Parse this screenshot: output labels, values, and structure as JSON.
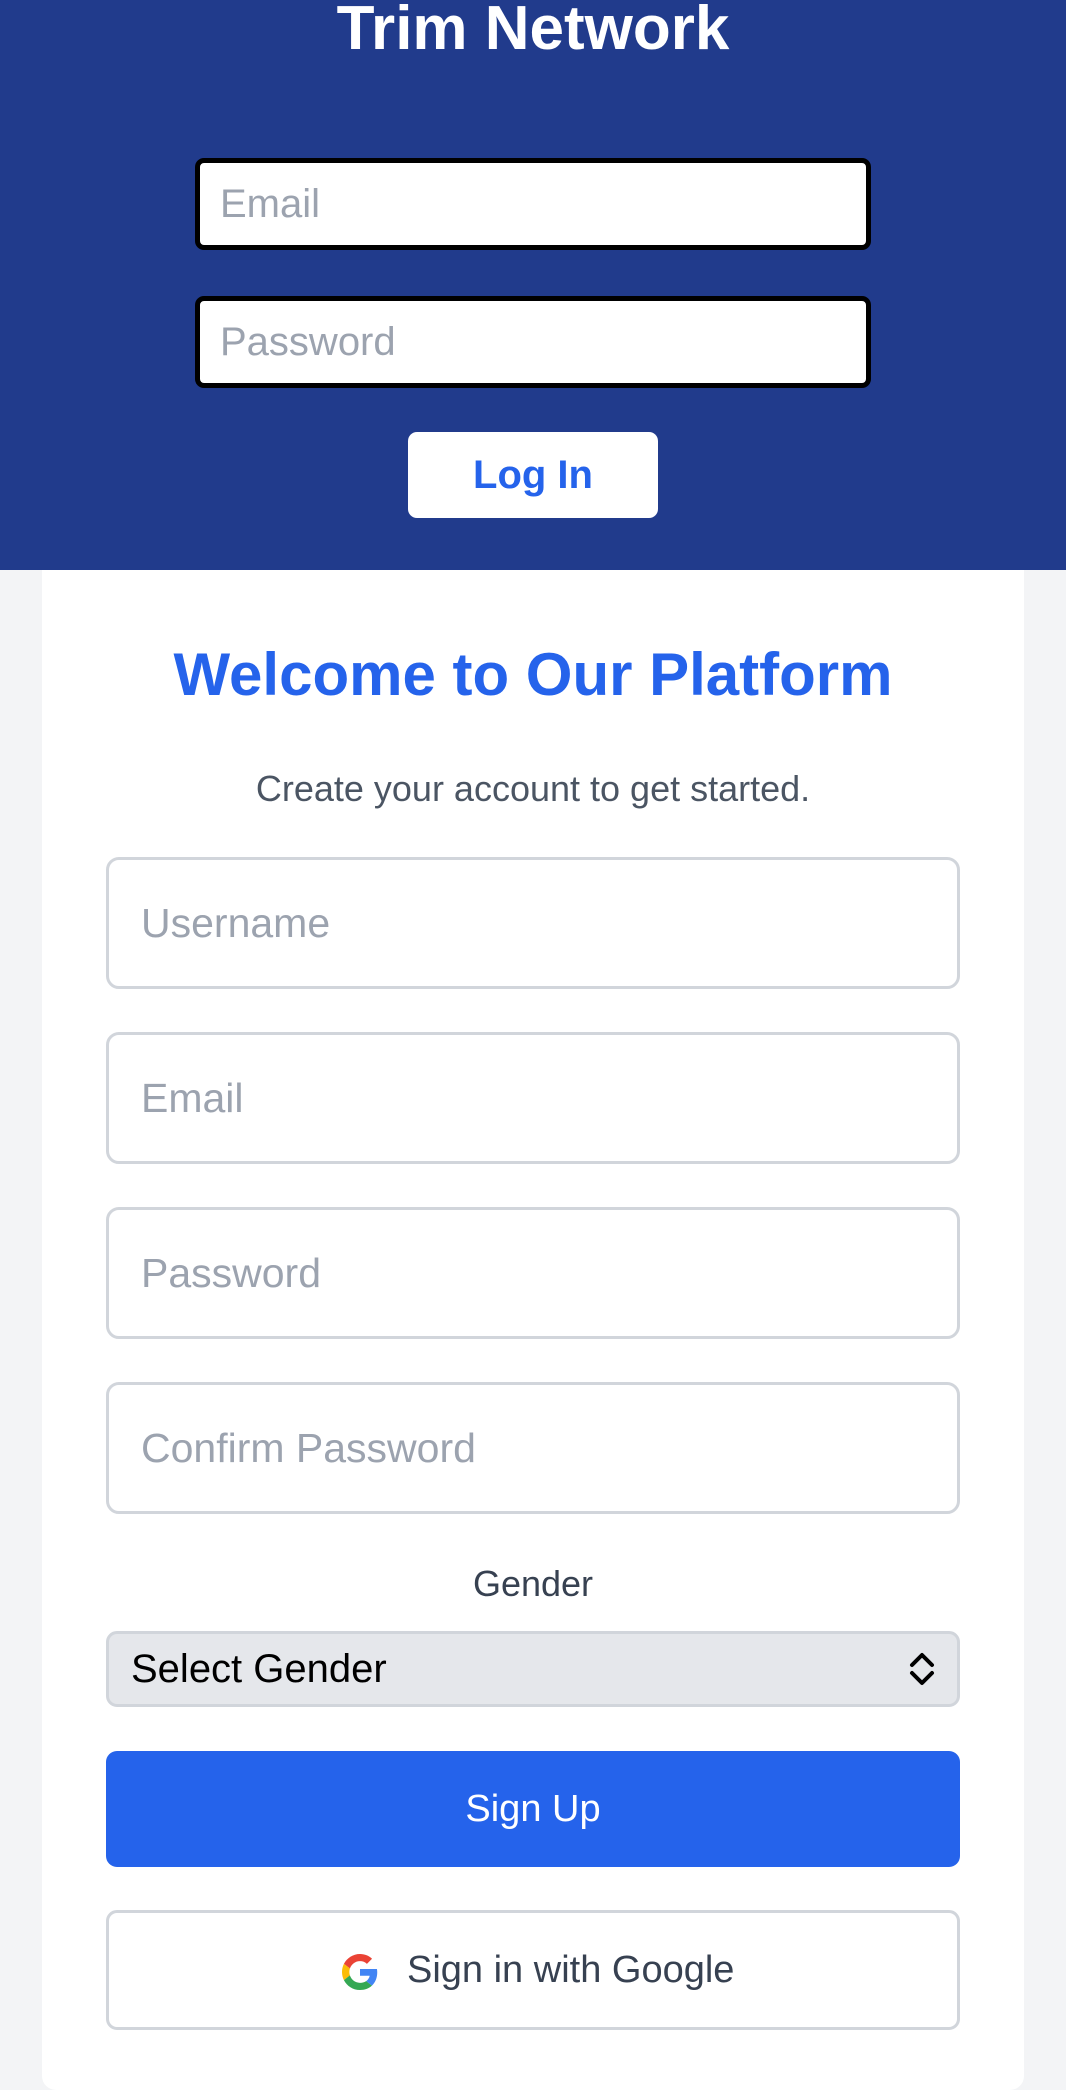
{
  "header": {
    "brand": "Trim Network",
    "email_placeholder": "Email",
    "password_placeholder": "Password",
    "login_label": "Log In"
  },
  "card": {
    "title": "Welcome to Our Platform",
    "subtitle": "Create your account to get started.",
    "fields": {
      "username_placeholder": "Username",
      "email_placeholder": "Email",
      "password_placeholder": "Password",
      "confirm_placeholder": "Confirm Password"
    },
    "gender_label": "Gender",
    "gender_selected": "Select Gender",
    "signup_label": "Sign Up",
    "google_label": "Sign in with Google"
  },
  "icons": {
    "select_arrows": "chevron-up-down-icon",
    "google": "google-icon"
  },
  "colors": {
    "header_bg": "#213b8c",
    "accent": "#2563eb",
    "page_bg": "#f3f4f6"
  }
}
